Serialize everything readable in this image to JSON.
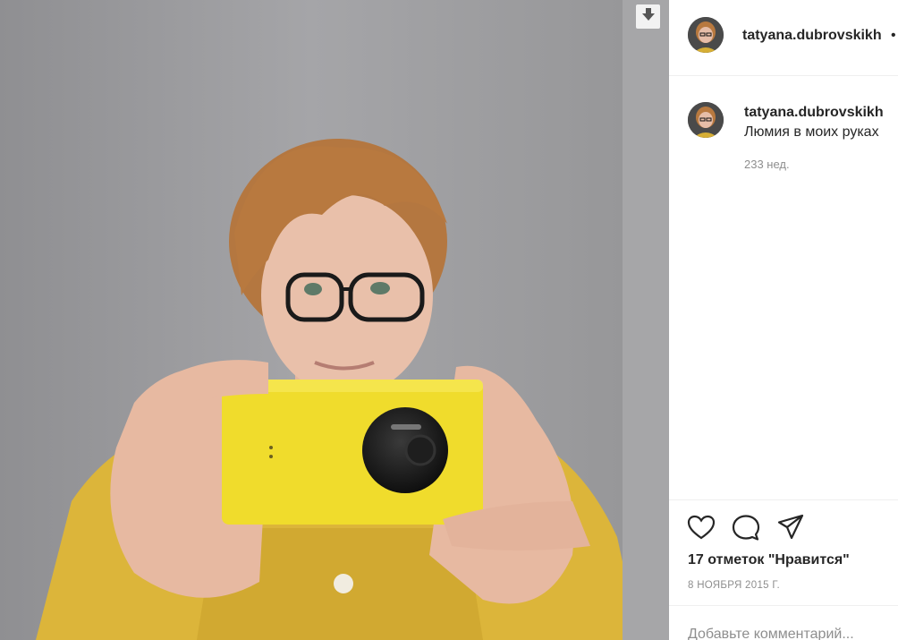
{
  "post": {
    "username": "tatyana.dubrovskikh",
    "header_dot": "•",
    "caption_username": "tatyana.dubrovskikh",
    "caption_text": "Люмия в моих руках",
    "caption_age": "233 нед.",
    "likes": "17 отметок \"Нравится\"",
    "date": "8 НОЯБРЯ 2015 Г.",
    "comment_placeholder": "Добавьте комментарий..."
  },
  "icons": {
    "download": "download-arrow-icon",
    "like": "heart-icon",
    "comment": "speech-bubble-icon",
    "share": "paper-plane-icon"
  },
  "colors": {
    "phone_yellow": "#f0dc2c",
    "sweater_yellow": "#e0b935",
    "hair": "#b87a45",
    "text_primary": "#262626",
    "text_secondary": "#8e8e8e"
  }
}
